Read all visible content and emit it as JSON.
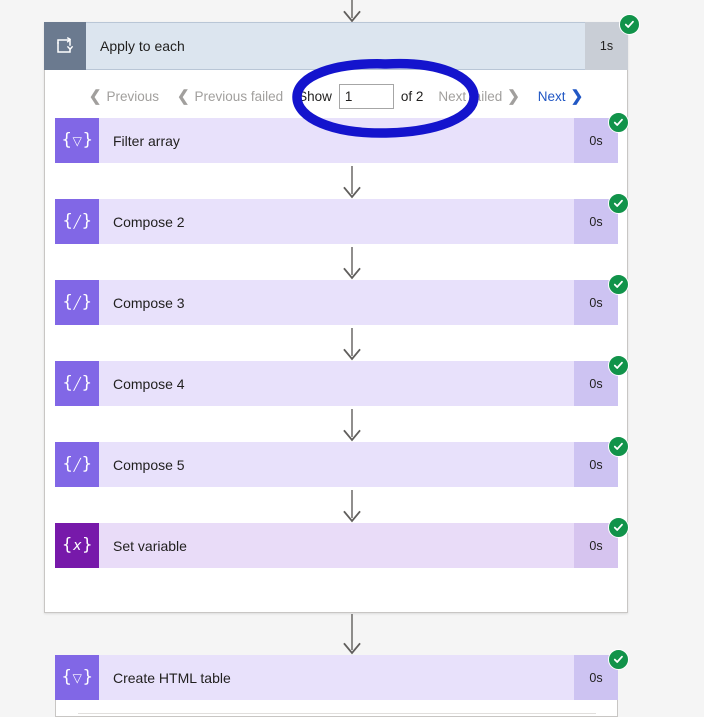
{
  "scope": {
    "title": "Apply to each",
    "duration": "1s",
    "icon": "loop-repeat-icon",
    "status": "succeeded",
    "header_bg": "#dce5ef",
    "icon_bg": "#6b7a8f"
  },
  "pager": {
    "previous_label": "Previous",
    "previous_failed_label": "Previous failed",
    "show_label": "Show",
    "page_value": "1",
    "of_label": "of 2",
    "next_failed_label": "Next failed",
    "next_label": "Next",
    "disabled_color": "#a19f9d",
    "enabled_color": "#2157c4"
  },
  "actions": [
    {
      "title": "Filter array",
      "duration": "0s",
      "icon": "filter-funnel-icon",
      "glyph": "▽",
      "status": "succeeded",
      "variant": "standard",
      "icon_bg": "#8167e6",
      "card_bg": "#e8e1fb"
    },
    {
      "title": "Compose 2",
      "duration": "0s",
      "icon": "compose-pencil-icon",
      "glyph": "∕",
      "status": "succeeded",
      "variant": "standard",
      "icon_bg": "#8167e6",
      "card_bg": "#e8e1fb"
    },
    {
      "title": "Compose 3",
      "duration": "0s",
      "icon": "compose-pencil-icon",
      "glyph": "∕",
      "status": "succeeded",
      "variant": "standard",
      "icon_bg": "#8167e6",
      "card_bg": "#e8e1fb"
    },
    {
      "title": "Compose 4",
      "duration": "0s",
      "icon": "compose-pencil-icon",
      "glyph": "∕",
      "status": "succeeded",
      "variant": "standard",
      "icon_bg": "#8167e6",
      "card_bg": "#e8e1fb"
    },
    {
      "title": "Compose 5",
      "duration": "0s",
      "icon": "compose-pencil-icon",
      "glyph": "∕",
      "status": "succeeded",
      "variant": "standard",
      "icon_bg": "#8167e6",
      "card_bg": "#e8e1fb"
    },
    {
      "title": "Set variable",
      "duration": "0s",
      "icon": "variable-x-icon",
      "glyph": "x",
      "status": "succeeded",
      "variant": "variable",
      "icon_bg": "#7719aa",
      "card_bg": "#e9dcf8"
    }
  ],
  "bottom_action": {
    "title": "Create HTML table",
    "duration": "0s",
    "icon": "filter-funnel-icon",
    "glyph": "▽",
    "status": "succeeded",
    "icon_bg": "#8167e6",
    "card_bg": "#e8e1fb"
  },
  "annotation": {
    "shape": "hand-drawn-ellipse",
    "color": "#1414cd",
    "target": "Show 1 of 2 pager control"
  },
  "canvas": {
    "background": "#f5f5f5",
    "connector_color": "#605e5c"
  }
}
